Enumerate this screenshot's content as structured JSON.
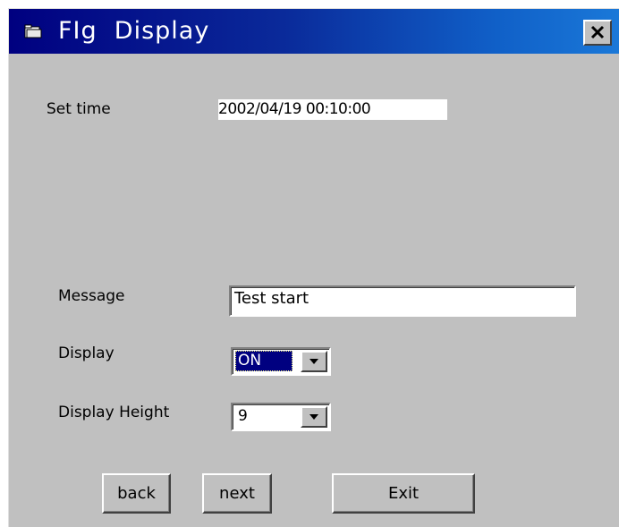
{
  "window": {
    "title": "FIg  Display",
    "close_icon": "close-icon",
    "app_icon": "folder-icon"
  },
  "form": {
    "set_time_label": "Set time",
    "set_time_value": "2002/04/19 00:10:00",
    "message_label": "Message",
    "message_value": "Test start",
    "display_label": "Display",
    "display_value": "ON",
    "display_height_label": "Display Height",
    "display_height_value": "9"
  },
  "buttons": {
    "back": "back",
    "next": "next",
    "exit": "Exit"
  },
  "colors": {
    "titlebar_start": "#000080",
    "titlebar_end": "#1a78d8",
    "face": "#c0c0c0",
    "selection": "#000080"
  }
}
